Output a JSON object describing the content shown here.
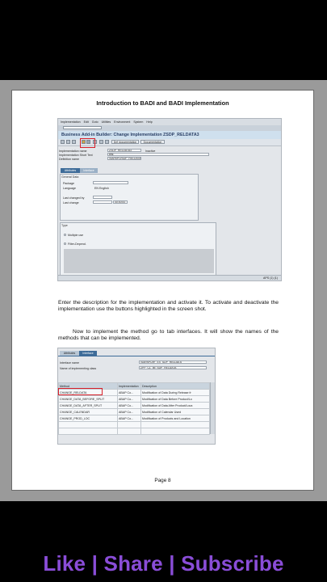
{
  "document": {
    "title": "Introduction to BADI and BADI Implementation",
    "page": "Page 8",
    "paragraph1": "Enter the description for the implementation and activate it. To activate and deactivate the implementation use the buttons highlighted in the screen shot.",
    "paragraph2": "Now to implement the method go to tab interfaces. It will show the names of the methods that can be implemented."
  },
  "screenshot1": {
    "menu": [
      "Implementation",
      "Edit",
      "Goto",
      "Utilities",
      "Environment",
      "System",
      "Help"
    ],
    "title": "Business Add-in Builder: Change Implementation ZSDP_RELDATA3",
    "buttons": {
      "def_doc": "Def documentation",
      "documentation": "Documentation"
    },
    "fields": {
      "impl_name_label": "Implementation name",
      "impl_name_value": "ZSDP_RELDATA3",
      "impl_status": "Inactive",
      "short_text_label": "Implementation Short Text",
      "short_text_value": "test",
      "def_name_label": "Definition name",
      "def_name_value": "/SAPAPO/SDP_RELDATA"
    },
    "tabs": [
      "Attributes",
      "Interface"
    ],
    "general_data": {
      "header": "General Data",
      "package_label": "Package",
      "language_label": "Language",
      "language_value": "EN English",
      "changed_by_label": "Last changed by",
      "last_change_label": "Last change",
      "last_change_time": "00:00:00"
    },
    "type": {
      "header": "Type",
      "multiple_use": "Multiple use",
      "filter_depend": "Filter-Depend."
    },
    "status": "APS (1) (1)"
  },
  "screenshot2": {
    "tabs": [
      "Attributes",
      "Interface"
    ],
    "interface_name_label": "Interface name",
    "interface_name_value": "/SAPAPO/IF_EX_SDP_RELDATA",
    "class_label": "Name of implementing class",
    "class_value": "ZPP_CL_IM_SDP_RELDATA",
    "columns": [
      "Method",
      "Implementation",
      "Description"
    ],
    "rows": [
      {
        "method": "CHANGE_RELDATA",
        "impl": "ABAP Co...",
        "desc": "Modification of Data During Release fr"
      },
      {
        "method": "CHANGE_DATA_BEFORE_SPLIT",
        "impl": "ABAP Co...",
        "desc": "Modification of Data Before Product/Lo"
      },
      {
        "method": "CHANGE_DATA_AFTER_SPLIT",
        "impl": "ABAP Co...",
        "desc": "Modification of Data After Product/Loca"
      },
      {
        "method": "CHANGE_CALENDAR",
        "impl": "ABAP Co...",
        "desc": "Modification of Calendar Used"
      },
      {
        "method": "CHANGE_PROD_LOC",
        "impl": "ABAP Co...",
        "desc": "Modification of Products and Location"
      }
    ]
  },
  "social": {
    "text": "Like | Share | Subscribe"
  },
  "colors": {
    "highlight": "#d8202a",
    "social": "#8a4dd8"
  }
}
